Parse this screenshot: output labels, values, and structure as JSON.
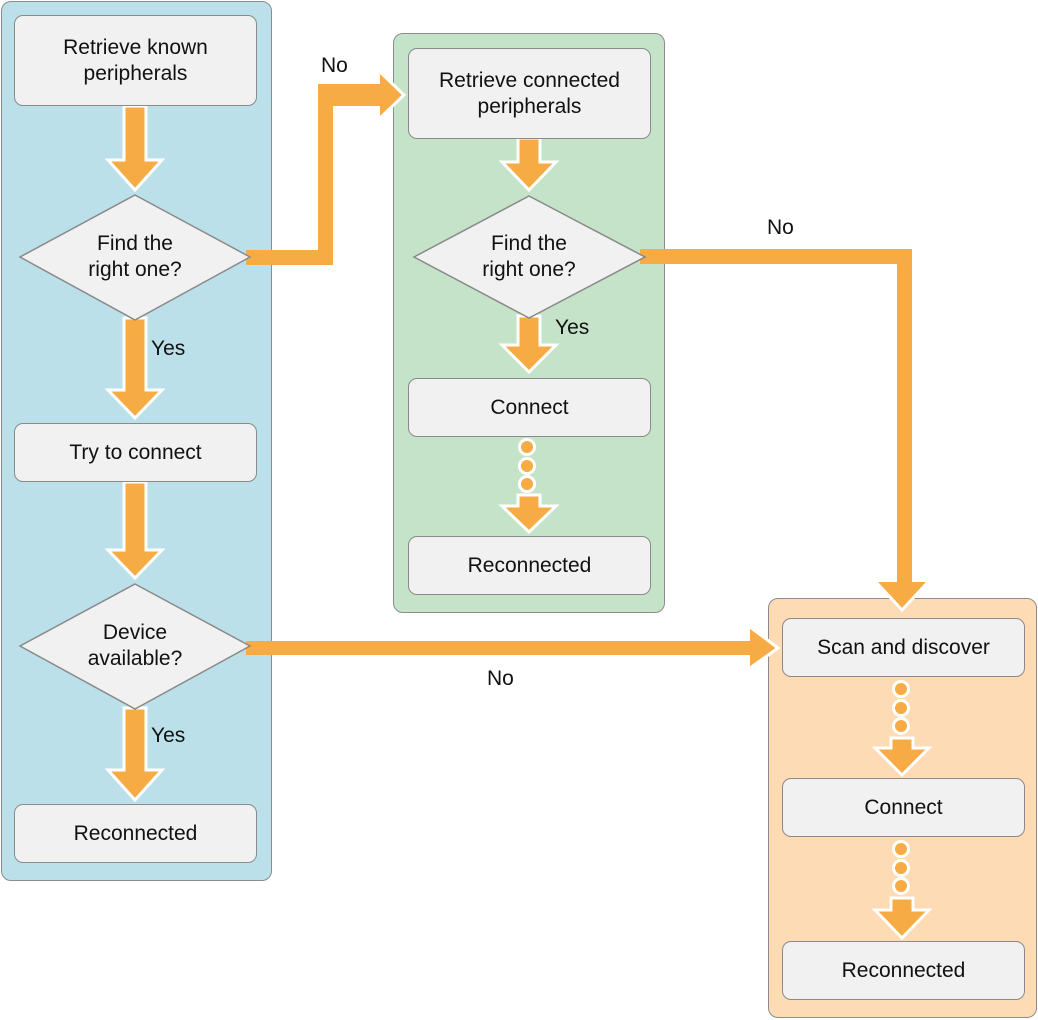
{
  "colors": {
    "panel_blue": "#bbe0ea",
    "panel_green": "#c5e3c9",
    "panel_orange": "#fddbb4",
    "node_fill": "#f1f1f1",
    "node_border": "#8a8a8a",
    "arrow": "#f7ab45",
    "arrow_outline": "#ffffff"
  },
  "panels": {
    "known": {
      "nodes": {
        "retrieve": "Retrieve known\nperipherals",
        "decision_find": "Find the\nright one?",
        "try_connect": "Try to connect",
        "decision_available": "Device\navailable?",
        "reconnected": "Reconnected"
      },
      "labels": {
        "find_yes": "Yes",
        "available_yes": "Yes"
      }
    },
    "connected": {
      "nodes": {
        "retrieve": "Retrieve connected\nperipherals",
        "decision_find": "Find the\nright one?",
        "connect": "Connect",
        "reconnected": "Reconnected"
      },
      "labels": {
        "find_yes": "Yes"
      }
    },
    "scan": {
      "nodes": {
        "scan": "Scan and discover",
        "connect": "Connect",
        "reconnected": "Reconnected"
      }
    }
  },
  "edge_labels": {
    "known_to_connected_no": "No",
    "connected_to_scan_no": "No",
    "available_to_scan_no": "No"
  }
}
